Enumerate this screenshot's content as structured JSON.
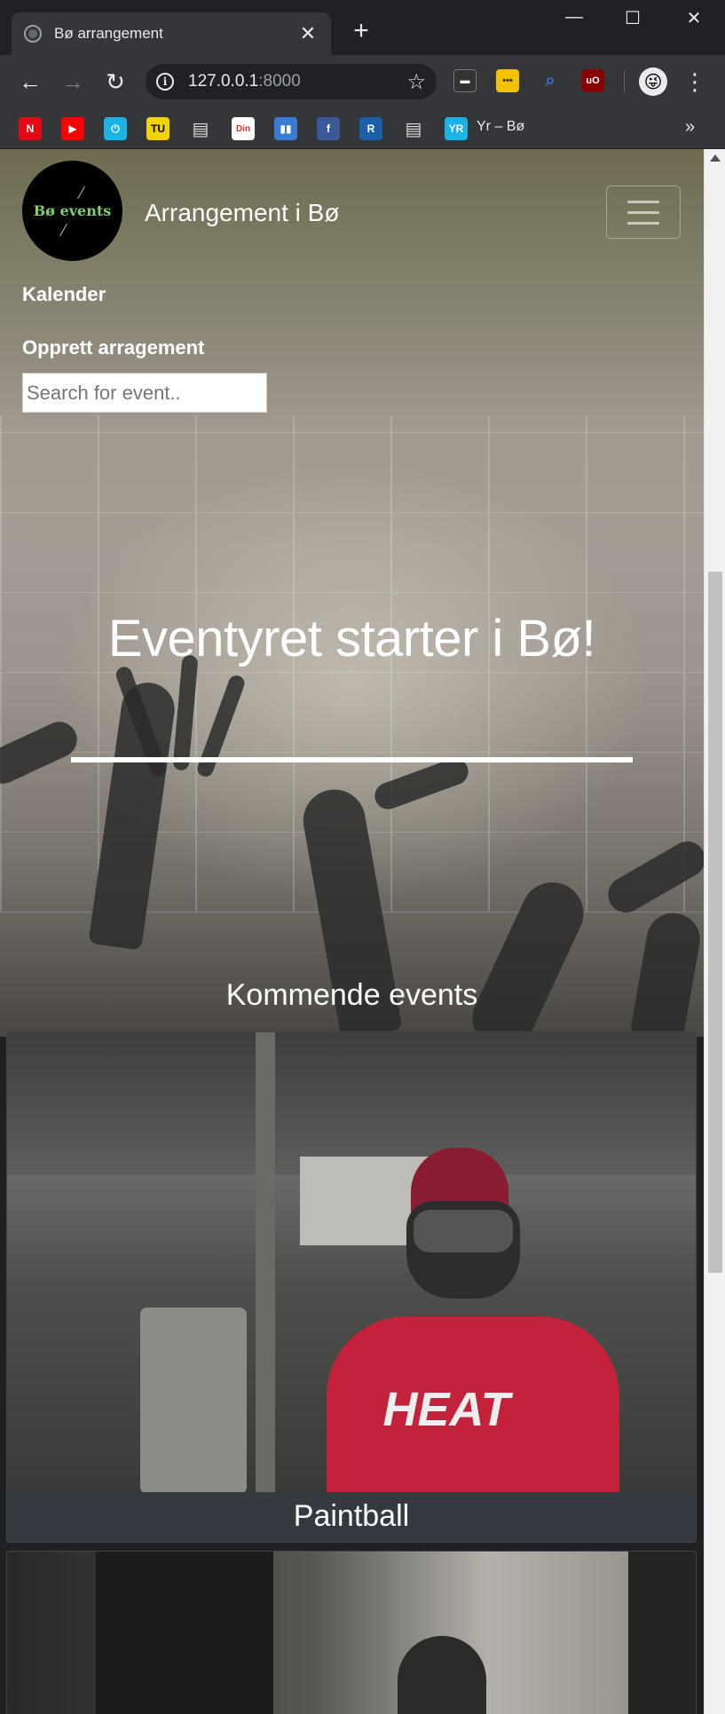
{
  "browser": {
    "tab_title": "Bø arrangement",
    "url_host": "127.0.0.1",
    "url_port": ":8000",
    "bookmarks": [
      {
        "icon": "netflix-icon",
        "glyph": "N",
        "color": "#e50914"
      },
      {
        "icon": "youtube-icon",
        "glyph": "▶",
        "color": "#ff0000"
      },
      {
        "icon": "power-icon",
        "glyph": "⏻",
        "color": "#1ab3e6"
      },
      {
        "icon": "tu-icon",
        "glyph": "TU",
        "color": "#f2d200"
      },
      {
        "icon": "bookmark-page-icon",
        "glyph": "▤",
        "color": "#ddd"
      },
      {
        "icon": "din-side-icon",
        "glyph": "Din",
        "color": "#d33"
      },
      {
        "icon": "book-icon",
        "glyph": "▮▮",
        "color": "#3a7bd5"
      },
      {
        "icon": "facebook-icon",
        "glyph": "f",
        "color": "#3b5998"
      },
      {
        "icon": "r-icon",
        "glyph": "R",
        "color": "#1c5fa8"
      },
      {
        "icon": "bookmark-page-icon",
        "glyph": "▤",
        "color": "#ddd"
      },
      {
        "icon": "yr-icon",
        "glyph": "YR",
        "color": "#1ab3e6"
      }
    ],
    "bookmark_label": "Yr – Bø",
    "more_bookmarks": "»"
  },
  "site": {
    "logo_text": "Bø events",
    "brand": "Arrangement i Bø",
    "nav": {
      "calendar": "Kalender",
      "create": "Opprett arragement"
    },
    "search_placeholder": "Search for event..",
    "hero_title": "Eventyret starter i Bø!",
    "section_title": "Kommende events",
    "events": [
      {
        "title": "Paintball"
      },
      {
        "title": ""
      }
    ]
  },
  "colors": {
    "card_title_bg": "#343a40",
    "logo_green": "#7fd16b"
  }
}
